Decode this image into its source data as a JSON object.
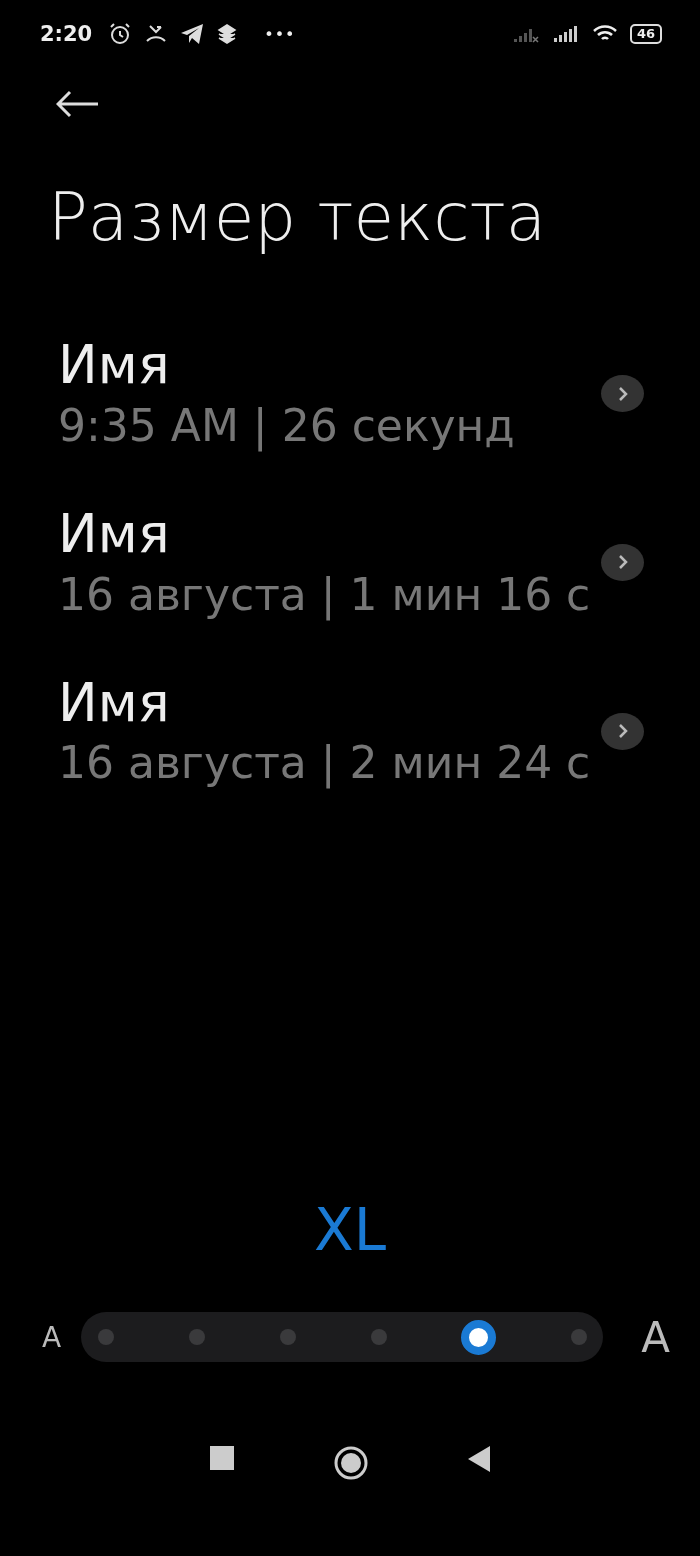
{
  "status_bar": {
    "time": "2:20",
    "more": "•••",
    "battery": "46"
  },
  "title": "Размер текста",
  "items": [
    {
      "name": "Имя",
      "detail": "9:35 AM | 26 секунд"
    },
    {
      "name": "Имя",
      "detail": "16 августа | 1 мин 16 с"
    },
    {
      "name": "Имя",
      "detail": "16 августа | 2 мин 24 с"
    }
  ],
  "size_label": "XL",
  "slider": {
    "small_label": "A",
    "large_label": "A",
    "steps": [
      {
        "selected": false
      },
      {
        "selected": false
      },
      {
        "selected": false
      },
      {
        "selected": false
      },
      {
        "selected": true
      },
      {
        "selected": false
      }
    ]
  }
}
